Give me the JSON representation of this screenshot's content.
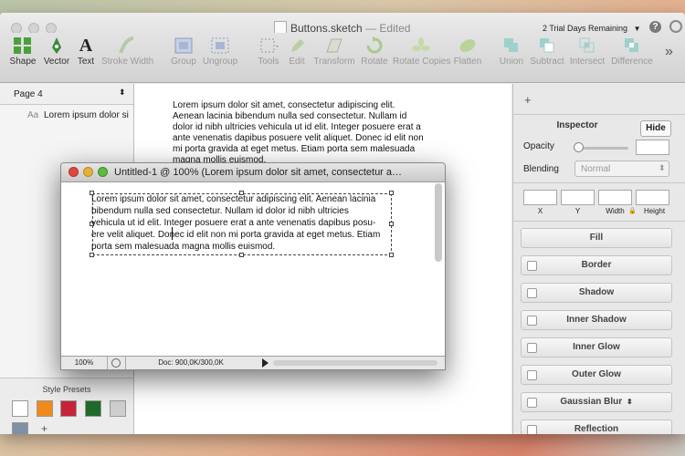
{
  "window": {
    "title": "Buttons.sketch",
    "edited": "— Edited",
    "trial": "2 Trial Days Remaining",
    "help": "?"
  },
  "toolbar": {
    "tools": [
      {
        "label": "Shape",
        "icon": "shape-icon",
        "enabled": true
      },
      {
        "label": "Vector",
        "icon": "vector-pen-icon",
        "enabled": true
      },
      {
        "label": "Text",
        "icon": "text-icon",
        "enabled": true
      },
      {
        "label": "Stroke Width",
        "icon": "stroke-width-icon",
        "enabled": false
      },
      {
        "label": "Group",
        "icon": "group-icon",
        "enabled": false
      },
      {
        "label": "Ungroup",
        "icon": "ungroup-icon",
        "enabled": false
      },
      {
        "label": "Tools",
        "icon": "tools-icon",
        "enabled": false
      },
      {
        "label": "Edit",
        "icon": "edit-icon",
        "enabled": false
      },
      {
        "label": "Transform",
        "icon": "transform-icon",
        "enabled": false
      },
      {
        "label": "Rotate",
        "icon": "rotate-icon",
        "enabled": false
      },
      {
        "label": "Rotate Copies",
        "icon": "rotate-copies-icon",
        "enabled": false
      },
      {
        "label": "Flatten",
        "icon": "flatten-icon",
        "enabled": false
      },
      {
        "label": "Union",
        "icon": "union-icon",
        "enabled": false
      },
      {
        "label": "Subtract",
        "icon": "subtract-icon",
        "enabled": false
      },
      {
        "label": "Intersect",
        "icon": "intersect-icon",
        "enabled": false
      },
      {
        "label": "Difference",
        "icon": "difference-icon",
        "enabled": false
      }
    ],
    "more": "»"
  },
  "sidebar": {
    "page_selector": "Page 4",
    "layer_prefix": "Aa",
    "layer_name": "Lorem ipsum dolor si",
    "style_presets_title": "Style Presets",
    "presets": [
      "#ffffff",
      "#f08a1c",
      "#c8243a",
      "#1f6b2c",
      "#cfcfcf",
      "#7f8fa6"
    ],
    "add": "+"
  },
  "canvas": {
    "text": "Lorem ipsum dolor sit amet, consectetur adipiscing elit. Aenean lacinia bibendum nulla sed consectetur. Nullam id dolor id nibh ultricies vehicula ut id elit. Integer posuere erat a ante venenatis dapibus posuere velit aliquet. Donec id elit non mi porta gravida at eget metus. Etiam porta sem malesuada magna mollis euismod."
  },
  "inspector": {
    "add": "+",
    "title": "Inspector",
    "hide": "Hide",
    "opacity_label": "Opacity",
    "opacity_value": 0,
    "blending_label": "Blending",
    "blending_value": "Normal",
    "fields": [
      "X",
      "Y",
      "Width",
      "Height"
    ],
    "fill": "Fill",
    "effects": [
      "Border",
      "Shadow",
      "Inner Shadow",
      "Inner Glow",
      "Outer Glow",
      "Gaussian Blur",
      "Reflection"
    ]
  },
  "float_window": {
    "title": "Untitled-1 @ 100% (Lorem ipsum dolor sit amet, consectetur a…",
    "zoom": "100%",
    "doc": "Doc: 900,0K/300,0K",
    "lines": [
      "Lorem ipsum dolor sit amet, consectetur adipiscing elit. Aenean lacinia",
      "bibendum nulla sed consectetur. Nullam id dolor id nibh ultricies",
      "vehicula ut id elit. Integer posuere erat a ante venenatis dapibus posu-",
      "ere velit aliquet. Donec id elit non mi porta gravida at eget metus. Etiam",
      "porta sem malesuada magna mollis euismod."
    ]
  }
}
